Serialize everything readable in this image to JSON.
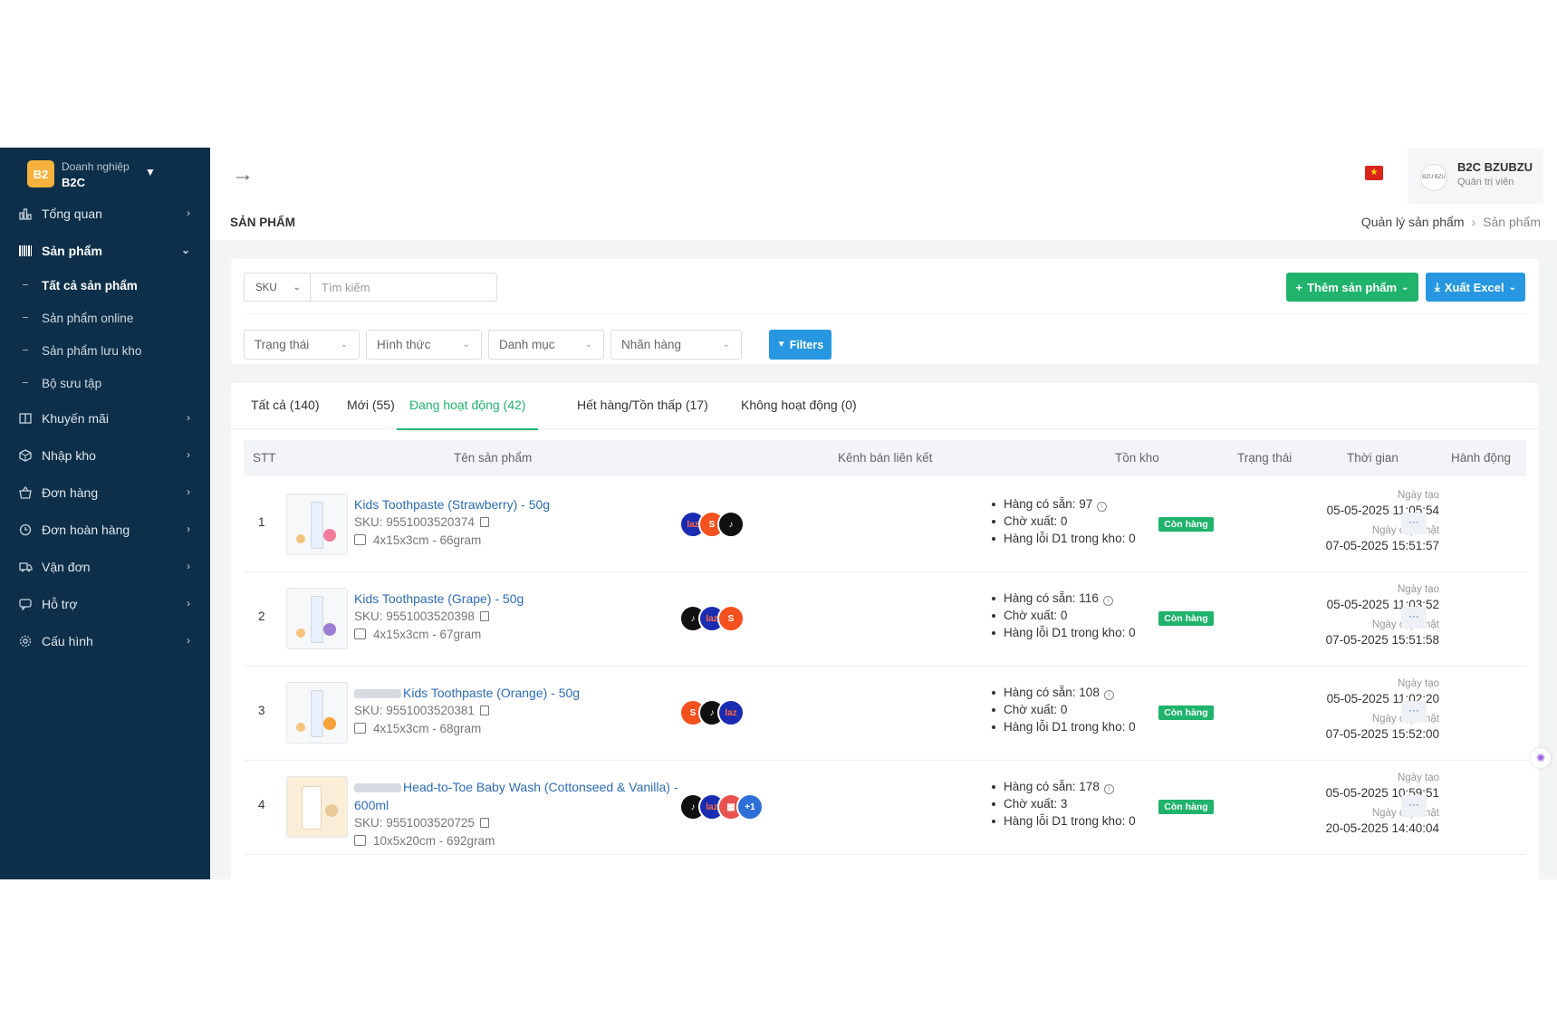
{
  "sidebar": {
    "brand_logo": "B2",
    "brand_sub": "Doanh nghiệp",
    "brand_name": "B2C",
    "items": [
      {
        "label": "Tổng quan",
        "icon": "chart-icon"
      },
      {
        "label": "Sản phẩm",
        "icon": "barcode-icon"
      },
      {
        "label": "Khuyến mãi",
        "icon": "promotion-icon"
      },
      {
        "label": "Nhập kho",
        "icon": "box-icon"
      },
      {
        "label": "Đơn hàng",
        "icon": "basket-icon"
      },
      {
        "label": "Đơn hoàn hàng",
        "icon": "return-icon"
      },
      {
        "label": "Vận đơn",
        "icon": "truck-icon"
      },
      {
        "label": "Hỗ trợ",
        "icon": "support-icon"
      },
      {
        "label": "Cấu hình",
        "icon": "gear-icon"
      }
    ],
    "sub_items": [
      "Tất cả sản phẩm",
      "Sản phẩm online",
      "Sản phẩm lưu kho",
      "Bộ sưu tập"
    ]
  },
  "header": {
    "user_name": "B2C BZUBZU",
    "user_role": "Quản trị viên",
    "avatar_text": "BZU BZU"
  },
  "page": {
    "title": "SẢN PHẨM",
    "breadcrumb": [
      "Quản lý sản phẩm",
      "Sản phẩm"
    ]
  },
  "filters": {
    "search_type": "SKU",
    "search_placeholder": "Tìm kiếm",
    "add_button": "Thêm sản phẩm",
    "export_button": "Xuất Excel",
    "dropdowns": [
      "Trạng thái",
      "Hình thức",
      "Danh mục",
      "Nhãn hàng"
    ],
    "filters_button": "Filters"
  },
  "tabs": [
    "Tất cả (140)",
    "Mới (55)",
    "Đang hoạt động (42)",
    "Hết hàng/Tồn thấp (17)",
    "Không hoạt động (0)"
  ],
  "table": {
    "headers": [
      "STT",
      "Tên sản phẩm",
      "Kênh bán liên kết",
      "Tồn kho",
      "Trạng thái",
      "Thời gian",
      "Hành động"
    ],
    "created_label": "Ngày tạo",
    "updated_label": "Ngày cập nhật",
    "action_label": "···",
    "rows": [
      {
        "stt": "1",
        "name": "Kids Toothpaste (Strawberry) - 50g",
        "sku": "SKU: 9551003520374",
        "dim": "4x15x3cm - 66gram",
        "channels": [
          "laz",
          "shopee",
          "tiktok"
        ],
        "stock_available": "Hàng có sẵn: 97",
        "stock_pending": "Chờ xuất: 0",
        "stock_defect": "Hàng lỗi D1 trong kho: 0",
        "status": "Còn hàng",
        "created": "05-05-2025 11:05:54",
        "updated": "07-05-2025 15:51:57"
      },
      {
        "stt": "2",
        "name": "Kids Toothpaste (Grape) - 50g",
        "sku": "SKU: 9551003520398",
        "dim": "4x15x3cm - 67gram",
        "channels": [
          "tiktok",
          "laz",
          "shopee"
        ],
        "stock_available": "Hàng có sẵn: 116",
        "stock_pending": "Chờ xuất: 0",
        "stock_defect": "Hàng lỗi D1 trong kho: 0",
        "status": "Còn hàng",
        "created": "05-05-2025 11:03:52",
        "updated": "07-05-2025 15:51:58"
      },
      {
        "stt": "3",
        "name": "Kids Toothpaste (Orange) - 50g",
        "sku": "SKU: 9551003520381",
        "dim": "4x15x3cm - 68gram",
        "channels": [
          "shopee",
          "tiktok",
          "laz"
        ],
        "stock_available": "Hàng có sẵn: 108",
        "stock_pending": "Chờ xuất: 0",
        "stock_defect": "Hàng lỗi D1 trong kho: 0",
        "status": "Còn hàng",
        "created": "05-05-2025 11:02:20",
        "updated": "07-05-2025 15:52:00"
      },
      {
        "stt": "4",
        "name": "Head-to-Toe Baby Wash (Cottonseed & Vanilla) - 600ml",
        "sku": "SKU: 9551003520725",
        "dim": "10x5x20cm - 692gram",
        "channels": [
          "tiktok",
          "laz",
          "tiki",
          "more"
        ],
        "more_label": "+1",
        "stock_available": "Hàng có sẵn: 178",
        "stock_pending": "Chờ xuất: 3",
        "stock_defect": "Hàng lỗi D1 trong kho: 0",
        "status": "Còn hàng",
        "created": "05-05-2025 10:59:51",
        "updated": "20-05-2025 14:40:04"
      }
    ]
  },
  "colors": {
    "sidebar_bg": "#0d2f49",
    "primary_green": "#1fb36b",
    "primary_blue": "#2697e0",
    "link_blue": "#2d6cb5"
  }
}
